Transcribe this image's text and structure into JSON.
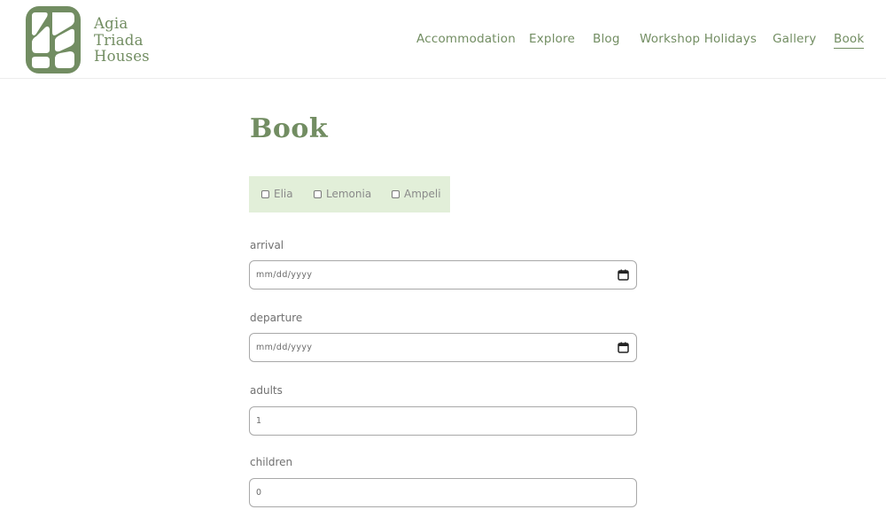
{
  "brand": {
    "line1": "Agia",
    "line2": "Triada",
    "line3": "Houses",
    "color": "#728d62"
  },
  "nav": {
    "items": [
      "Accommodation",
      "Explore",
      "Blog",
      "Workshop Holidays",
      "Gallery",
      "Book"
    ],
    "active": "Book"
  },
  "page": {
    "title": "Book"
  },
  "houses": [
    {
      "label": "Elia",
      "checked": false
    },
    {
      "label": "Lemonia",
      "checked": false
    },
    {
      "label": "Ampeli",
      "checked": false
    }
  ],
  "form": {
    "arrival": {
      "label": "arrival",
      "value": "mm/dd/yyyy"
    },
    "departure": {
      "label": "departure",
      "value": "mm/dd/yyyy"
    },
    "adults": {
      "label": "adults",
      "value": "1"
    },
    "children": {
      "label": "children",
      "value": "0"
    }
  },
  "icons": {
    "logo": "leaf-logo-icon",
    "date_picker": "calendar-icon",
    "checkbox": "checkbox-icon"
  },
  "colors": {
    "accent": "#728d62",
    "house_box_bg": "#e2efd9",
    "field_border": "#a8a8a8"
  }
}
